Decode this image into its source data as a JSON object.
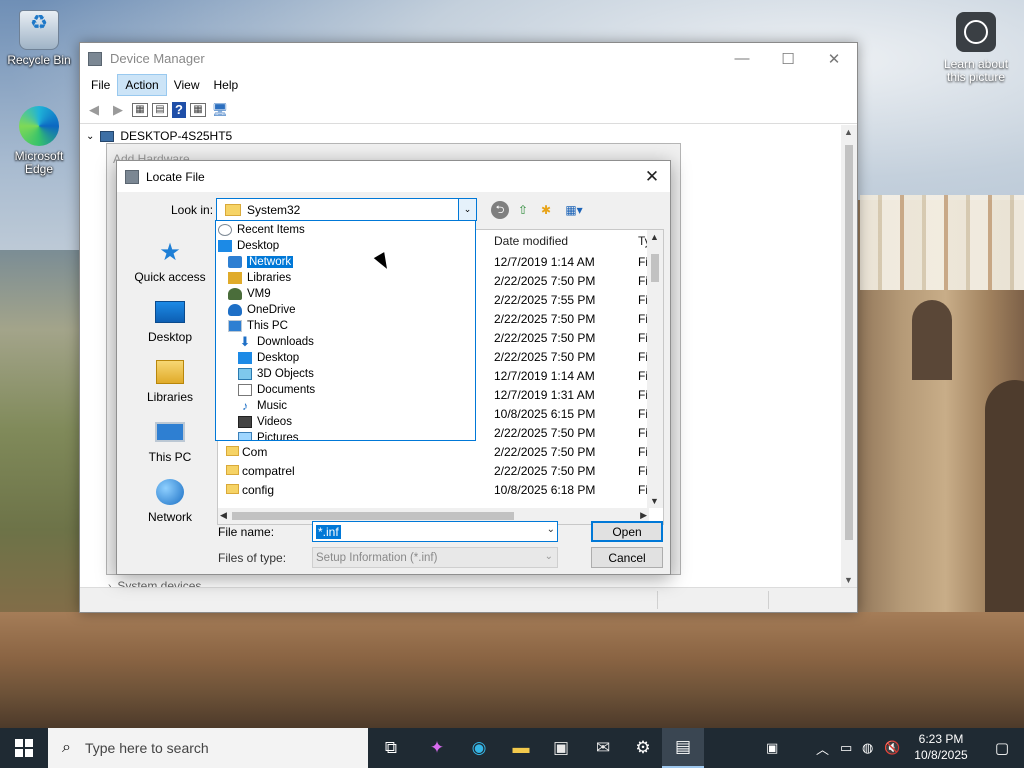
{
  "desktop": {
    "icons": [
      {
        "label": "Recycle Bin"
      },
      {
        "label": "Microsoft Edge"
      }
    ],
    "learn_label": "Learn about this picture"
  },
  "device_manager": {
    "title": "Device Manager",
    "menu": [
      "File",
      "Action",
      "View",
      "Help"
    ],
    "active_menu": "Action",
    "tree_root": "DESKTOP-4S25HT5",
    "ghost_add_hardware": "Add Hardware",
    "tree_bottom_item": "System devices"
  },
  "dialog": {
    "title": "Locate File",
    "look_in_label": "Look in:",
    "look_in_value": "System32",
    "places": [
      "Quick access",
      "Desktop",
      "Libraries",
      "This PC",
      "Network"
    ],
    "columns": {
      "date": "Date modified",
      "type": "Ty"
    },
    "files": [
      {
        "name": "",
        "date": "12/7/2019 1:14 AM",
        "type": "Fil"
      },
      {
        "name": "",
        "date": "2/22/2025 7:50 PM",
        "type": "Fil"
      },
      {
        "name": "",
        "date": "2/22/2025 7:55 PM",
        "type": "Fil"
      },
      {
        "name": "",
        "date": "2/22/2025 7:50 PM",
        "type": "Fil"
      },
      {
        "name": "",
        "date": "2/22/2025 7:50 PM",
        "type": "Fil"
      },
      {
        "name": "",
        "date": "2/22/2025 7:50 PM",
        "type": "Fil"
      },
      {
        "name": "",
        "date": "12/7/2019 1:14 AM",
        "type": "Fil"
      },
      {
        "name": "",
        "date": "12/7/2019 1:31 AM",
        "type": "Fil"
      },
      {
        "name": "",
        "date": "10/8/2025 6:15 PM",
        "type": "Fil"
      },
      {
        "name": "",
        "date": "2/22/2025 7:50 PM",
        "type": "Fil"
      },
      {
        "name": "Com",
        "date": "2/22/2025 7:50 PM",
        "type": "Fil"
      },
      {
        "name": "compatrel",
        "date": "2/22/2025 7:50 PM",
        "type": "Fil"
      },
      {
        "name": "config",
        "date": "10/8/2025 6:18 PM",
        "type": "Fil"
      }
    ],
    "dropdown": [
      {
        "label": "Recent Items",
        "icon": "recent"
      },
      {
        "label": "Desktop",
        "icon": "desk"
      },
      {
        "label": "Network",
        "icon": "net",
        "selected": true
      },
      {
        "label": "Libraries",
        "icon": "lib"
      },
      {
        "label": "VM9",
        "icon": "user"
      },
      {
        "label": "OneDrive",
        "icon": "od"
      },
      {
        "label": "This PC",
        "icon": "pc"
      },
      {
        "label": "Downloads",
        "icon": "dl"
      },
      {
        "label": "Desktop",
        "icon": "desk"
      },
      {
        "label": "3D Objects",
        "icon": "obj"
      },
      {
        "label": "Documents",
        "icon": "doc"
      },
      {
        "label": "Music",
        "icon": "music"
      },
      {
        "label": "Videos",
        "icon": "video"
      },
      {
        "label": "Pictures",
        "icon": "pic"
      }
    ],
    "file_name_label": "File name:",
    "file_name_value": "*.inf",
    "files_of_type_label": "Files of type:",
    "files_of_type_value": "Setup Information (*.inf)",
    "open_label": "Open",
    "cancel_label": "Cancel"
  },
  "taskbar": {
    "search_placeholder": "Type here to search",
    "time": "6:23 PM",
    "date": "10/8/2025"
  }
}
